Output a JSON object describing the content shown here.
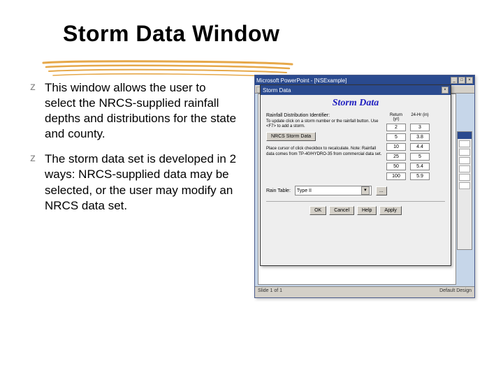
{
  "slide": {
    "title": "Storm Data Window",
    "bullets": [
      "This window allows the user to select the NRCS-supplied rainfall depths and distributions for the state and county.",
      "The storm data set is developed in 2 ways: NRCS-supplied data may be selected, or the user may modify an NRCS data set."
    ]
  },
  "app": {
    "title": "Microsoft PowerPoint - [NSExample]",
    "status_left": "Slide 1 of 1",
    "status_right": "Default Design"
  },
  "dialog": {
    "bar_title": "Storm Data",
    "title": "Storm Data",
    "subhead": "Rainfall Distribution Identifier:",
    "hint1": "To update click on a storm number or the rainfall button. Use <F7> to add a storm.",
    "btn": "NRCS Storm Data",
    "hint2": "Place cursor of click checkbox to recalculate. Note: Rainfall data comes from TP-40/HYDRO-35 from commercial data set.",
    "sel_label": "Rain Table:",
    "sel_value": "Type II",
    "grid_headers": [
      "Return (yr)",
      "24-Hr (in)"
    ],
    "grid_rows": [
      [
        "2",
        "3"
      ],
      [
        "5",
        "3.8"
      ],
      [
        "10",
        "4.4"
      ],
      [
        "25",
        "5"
      ],
      [
        "50",
        "5.4"
      ],
      [
        "100",
        "5.9"
      ]
    ],
    "sq_btn": "...",
    "buttons": [
      "OK",
      "Cancel",
      "Help",
      "Apply"
    ]
  }
}
